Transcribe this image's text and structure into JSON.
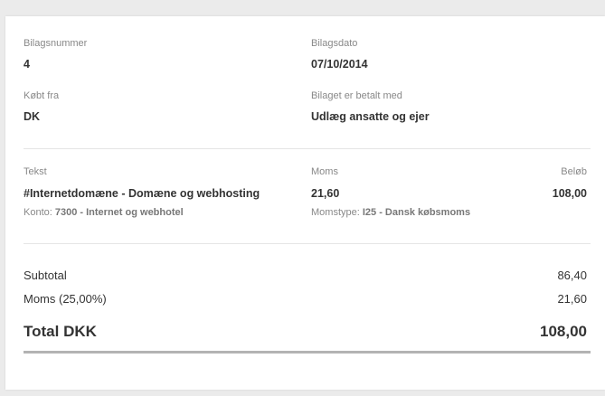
{
  "header": {
    "voucher_number_label": "Bilagsnummer",
    "voucher_number": "4",
    "voucher_date_label": "Bilagsdato",
    "voucher_date": "07/10/2014",
    "bought_from_label": "Købt fra",
    "bought_from": "DK",
    "paid_with_label": "Bilaget er betalt med",
    "paid_with": "Udlæg ansatte og ejer"
  },
  "lines": {
    "col_text": "Tekst",
    "col_vat": "Moms",
    "col_amount": "Beløb",
    "items": [
      {
        "text": "#Internetdomæne - Domæne og webhosting",
        "account_label": "Konto:",
        "account": "7300 - Internet og webhotel",
        "vat": "21,60",
        "vat_type_label": "Momstype:",
        "vat_type": "I25 - Dansk købsmoms",
        "amount": "108,00"
      }
    ]
  },
  "totals": {
    "subtotal_label": "Subtotal",
    "subtotal": "86,40",
    "vat_label": "Moms (25,00%)",
    "vat": "21,60",
    "total_label": "Total DKK",
    "total": "108,00"
  }
}
